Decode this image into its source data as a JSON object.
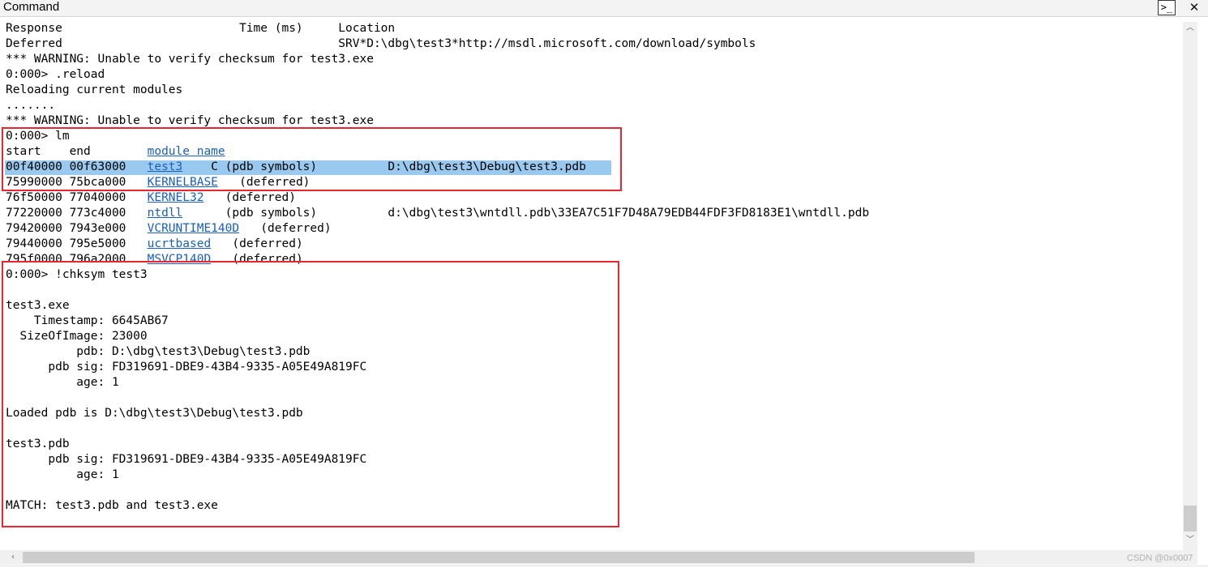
{
  "window": {
    "title": "Command",
    "cmd_icon": "command-prompt-icon",
    "close_icon": "close-icon",
    "close_glyph": "✕"
  },
  "output_lines": [
    "Response                         Time (ms)     Location",
    "Deferred                                       SRV*D:\\dbg\\test3*http://msdl.microsoft.com/download/symbols",
    "*** WARNING: Unable to verify checksum for test3.exe",
    "0:000> .reload",
    "Reloading current modules",
    ".......",
    "*** WARNING: Unable to verify checksum for test3.exe",
    "0:000> lm",
    "start    end        module name",
    "00f40000 00f63000   test3    C (pdb symbols)          D:\\dbg\\test3\\Debug\\test3.pdb",
    "75990000 75bca000   KERNELBASE   (deferred)",
    "76f50000 77040000   KERNEL32   (deferred)",
    "77220000 773c4000   ntdll      (pdb symbols)          d:\\dbg\\test3\\wntdll.pdb\\33EA7C51F7D48A79EDB44FDF3FD8183E1\\wntdll.pdb",
    "79420000 7943e000   VCRUNTIME140D   (deferred)",
    "79440000 795e5000   ucrtbased   (deferred)",
    "795f0000 796a2000   MSVCP140D   (deferred)",
    "0:000> !chksym test3",
    "",
    "test3.exe",
    "    Timestamp: 6645AB67",
    "  SizeOfImage: 23000",
    "          pdb: D:\\dbg\\test3\\Debug\\test3.pdb",
    "      pdb sig: FD319691-DBE9-43B4-9335-A05E49A819FC",
    "          age: 1",
    "",
    "Loaded pdb is D:\\dbg\\test3\\Debug\\test3.pdb",
    "",
    "test3.pdb",
    "      pdb sig: FD319691-DBE9-43B4-9335-A05E49A819FC",
    "          age: 1",
    "",
    "MATCH: test3.pdb and test3.exe"
  ],
  "module_links": [
    "module name",
    "test3",
    "KERNELBASE",
    "KERNEL32",
    "ntdll",
    "VCRUNTIME140D",
    "ucrtbased",
    "MSVCP140D"
  ],
  "scrollbars": {
    "up_glyph": "︿",
    "down_glyph": "﹀",
    "left_glyph": "‹"
  },
  "watermark": "CSDN @0x0007",
  "colors": {
    "link": "#1a5fbd",
    "selection": "#99c9ef",
    "highlight_box": "#e8262f"
  }
}
